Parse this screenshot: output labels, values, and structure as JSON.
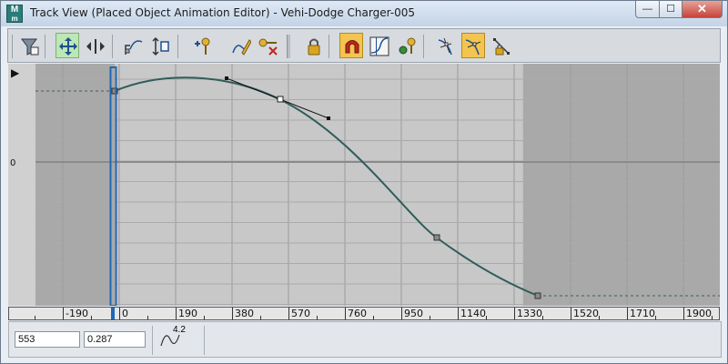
{
  "window": {
    "title": "Track View (Placed Object Animation Editor) - Vehi-Dodge Charger-005",
    "app_icon_letter": "M",
    "buttons": {
      "minimize": "—",
      "maximize": "☐",
      "close": "✕"
    }
  },
  "toolbar": {
    "tools": [
      "filters-icon",
      "move-keys-icon",
      "slide-keys-icon",
      "scale-keys-icon",
      "scale-values-icon",
      "add-keys-icon",
      "draw-curves-icon",
      "reduce-keys-icon",
      "lock-selection-icon",
      "snap-frames-icon",
      "parameter-curve-out-of-range-icon",
      "show-keyable-icon",
      "show-all-tangents-icon",
      "show-tangents-icon",
      "lock-tangents-icon"
    ],
    "active_green": [
      "move-keys-icon"
    ],
    "active_yellow": [
      "snap-frames-icon",
      "show-tangents-icon"
    ]
  },
  "graph": {
    "value_axis_label": "0",
    "range_start_marker": "▶",
    "keys_frames": [
      -15,
      1360
    ],
    "current_frame": -20
  },
  "ruler": {
    "labels": [
      "-190",
      "0",
      "190",
      "380",
      "570",
      "760",
      "950",
      "1140",
      "1330",
      "1520",
      "1710",
      "1900"
    ]
  },
  "status": {
    "frame_value": "553",
    "key_value": "0.287",
    "curve_readout": "4.2"
  },
  "colors": {
    "curve": "#2f5d5a",
    "time_slider": "#1f68b4",
    "active_green": "#bde8b5",
    "active_yellow": "#f3c44f"
  }
}
